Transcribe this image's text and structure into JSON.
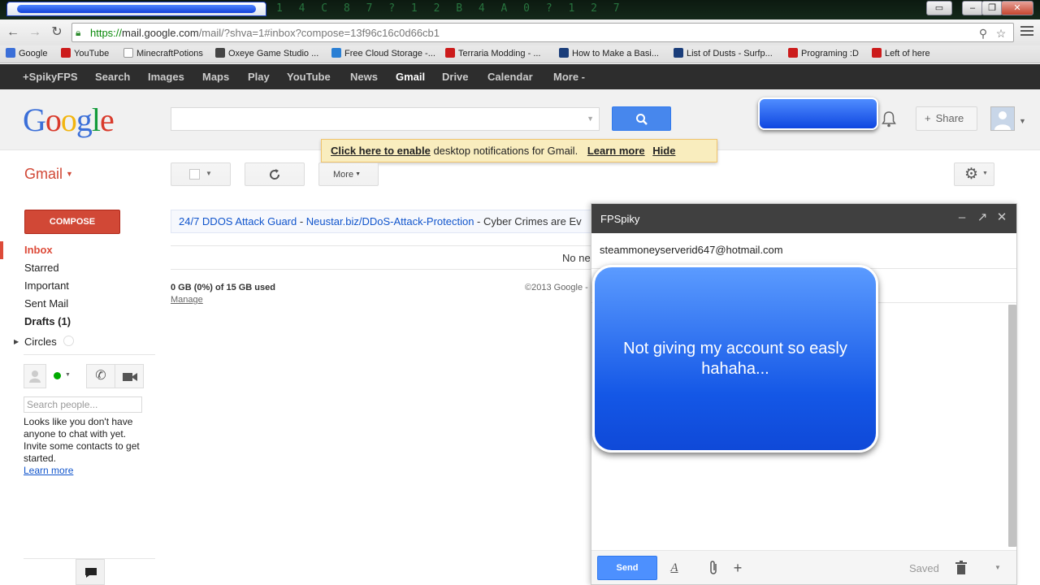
{
  "browser": {
    "url_https": "https://",
    "url_host": "mail.google.com",
    "url_rest": "/mail/?shva=1#inbox?compose=13f96c16c0d66cb1",
    "titlebar_glyphs": "1 4 C 8 7 ? 1 2 B 4 A 0 ? 1 2 7"
  },
  "bookmarks": [
    {
      "label": "Google",
      "color": "#3b6fd8"
    },
    {
      "label": "YouTube",
      "color": "#cc1b1b"
    },
    {
      "label": "MinecraftPotions",
      "color": "#ffffff"
    },
    {
      "label": "Oxeye Game Studio ...",
      "color": "#444444"
    },
    {
      "label": "Free Cloud Storage -...",
      "color": "#2a7fd4"
    },
    {
      "label": "Terraria Modding - ...",
      "color": "#cc1b1b"
    },
    {
      "label": "How to Make a Basi...",
      "color": "#1a3d7a"
    },
    {
      "label": "List of Dusts - Surfp...",
      "color": "#1a3d7a"
    },
    {
      "label": "Programing :D",
      "color": "#cc1b1b"
    },
    {
      "label": "Left of here",
      "color": "#cc1b1b"
    }
  ],
  "gbar": [
    "+SpikyFPS",
    "Search",
    "Images",
    "Maps",
    "Play",
    "YouTube",
    "News",
    "Gmail",
    "Drive",
    "Calendar",
    "More -"
  ],
  "gbar_active": "Gmail",
  "header": {
    "logo_letters": [
      "G",
      "o",
      "o",
      "g",
      "l",
      "e"
    ],
    "logo_colors": [
      "#3b6fd8",
      "#d93a2b",
      "#f2b50f",
      "#3b6fd8",
      "#129b3a",
      "#d93a2b"
    ],
    "share_label": "Share"
  },
  "notification": {
    "link": "Click here to enable",
    "text": " desktop notifications for Gmail.",
    "learn_more": "Learn more",
    "hide": "Hide"
  },
  "toolbar": {
    "gmail_label": "Gmail",
    "more_label": "More"
  },
  "nav": {
    "compose_label": "COMPOSE",
    "items": [
      "Inbox",
      "Starred",
      "Important",
      "Sent Mail",
      "Drafts (1)",
      "Circles"
    ]
  },
  "chat": {
    "search_placeholder": "Search people...",
    "message": "Looks like you don't have anyone to chat with yet. Invite some contacts to get started.",
    "learn_more": "Learn more"
  },
  "main": {
    "ad_title": "24/7 DDOS Attack Guard",
    "ad_sep": " - ",
    "ad_url": "Neustar.biz/DDoS-Attack-Protection",
    "ad_text": " - Cyber Crimes are Ev",
    "no_new": "No ne",
    "storage": "0 GB (0%) of 15 GB used",
    "manage": "Manage",
    "copyright": "©2013 Google -"
  },
  "compose_window": {
    "title": "FPSpiky",
    "to": "steammoneyserverid647@hotmail.com",
    "send_label": "Send",
    "saved_label": "Saved"
  },
  "overlay": {
    "text": "Not giving my account so easly hahaha..."
  },
  "colors": {
    "accent_red": "#d14836",
    "send_blue": "#4d90fe"
  }
}
